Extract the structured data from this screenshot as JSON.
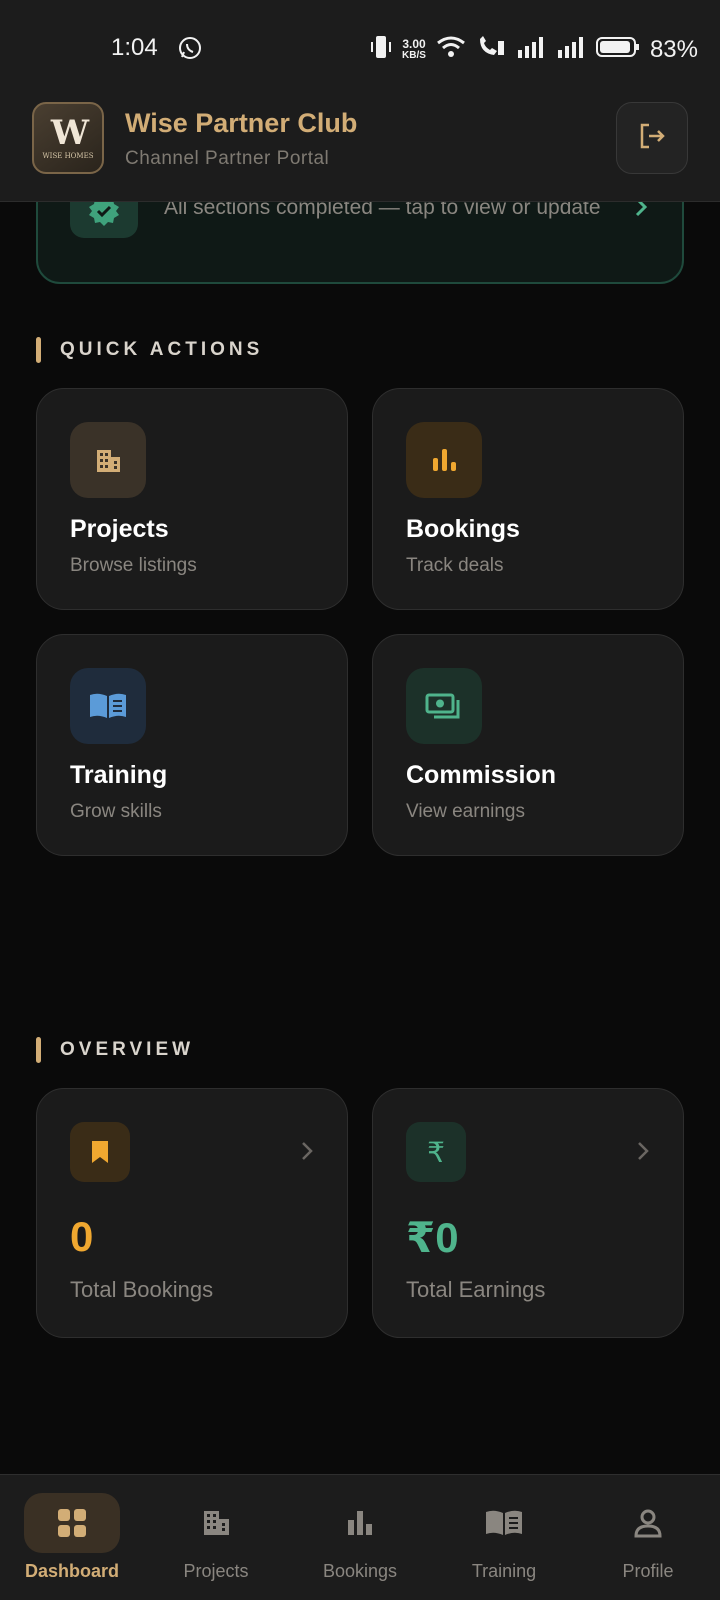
{
  "status_bar": {
    "time": "1:04",
    "speed_value": "3.00",
    "speed_unit": "KB/S",
    "battery_percent": "83%"
  },
  "header": {
    "logo_mark": "W",
    "logo_text": "WISE HOMES",
    "title": "Wise Partner Club",
    "subtitle": "Channel Partner Portal"
  },
  "profile_banner": {
    "text": "All sections completed — tap to view or update"
  },
  "quick_actions": {
    "title": "QUICK ACTIONS",
    "items": [
      {
        "title": "Projects",
        "subtitle": "Browse listings",
        "icon": "building-icon"
      },
      {
        "title": "Bookings",
        "subtitle": "Track deals",
        "icon": "bar-chart-icon"
      },
      {
        "title": "Training",
        "subtitle": "Grow skills",
        "icon": "book-icon"
      },
      {
        "title": "Commission",
        "subtitle": "View earnings",
        "icon": "money-icon"
      }
    ]
  },
  "overview": {
    "title": "OVERVIEW",
    "stats": [
      {
        "value": "0",
        "label": "Total Bookings",
        "icon": "bookmark-icon"
      },
      {
        "value": "₹0",
        "label": "Total Earnings",
        "icon": "rupee-icon"
      }
    ]
  },
  "bottom_nav": {
    "items": [
      {
        "label": "Dashboard",
        "icon": "dashboard-icon",
        "active": true
      },
      {
        "label": "Projects",
        "icon": "building-icon"
      },
      {
        "label": "Bookings",
        "icon": "bar-chart-icon"
      },
      {
        "label": "Training",
        "icon": "book-icon"
      },
      {
        "label": "Profile",
        "icon": "person-icon"
      }
    ]
  },
  "colors": {
    "accent_gold": "#d2ad76",
    "accent_orange": "#f0a830",
    "accent_green": "#4fb48c",
    "accent_blue": "#5b9bd8",
    "background": "#0a0a0a",
    "card": "#1b1b1b"
  }
}
